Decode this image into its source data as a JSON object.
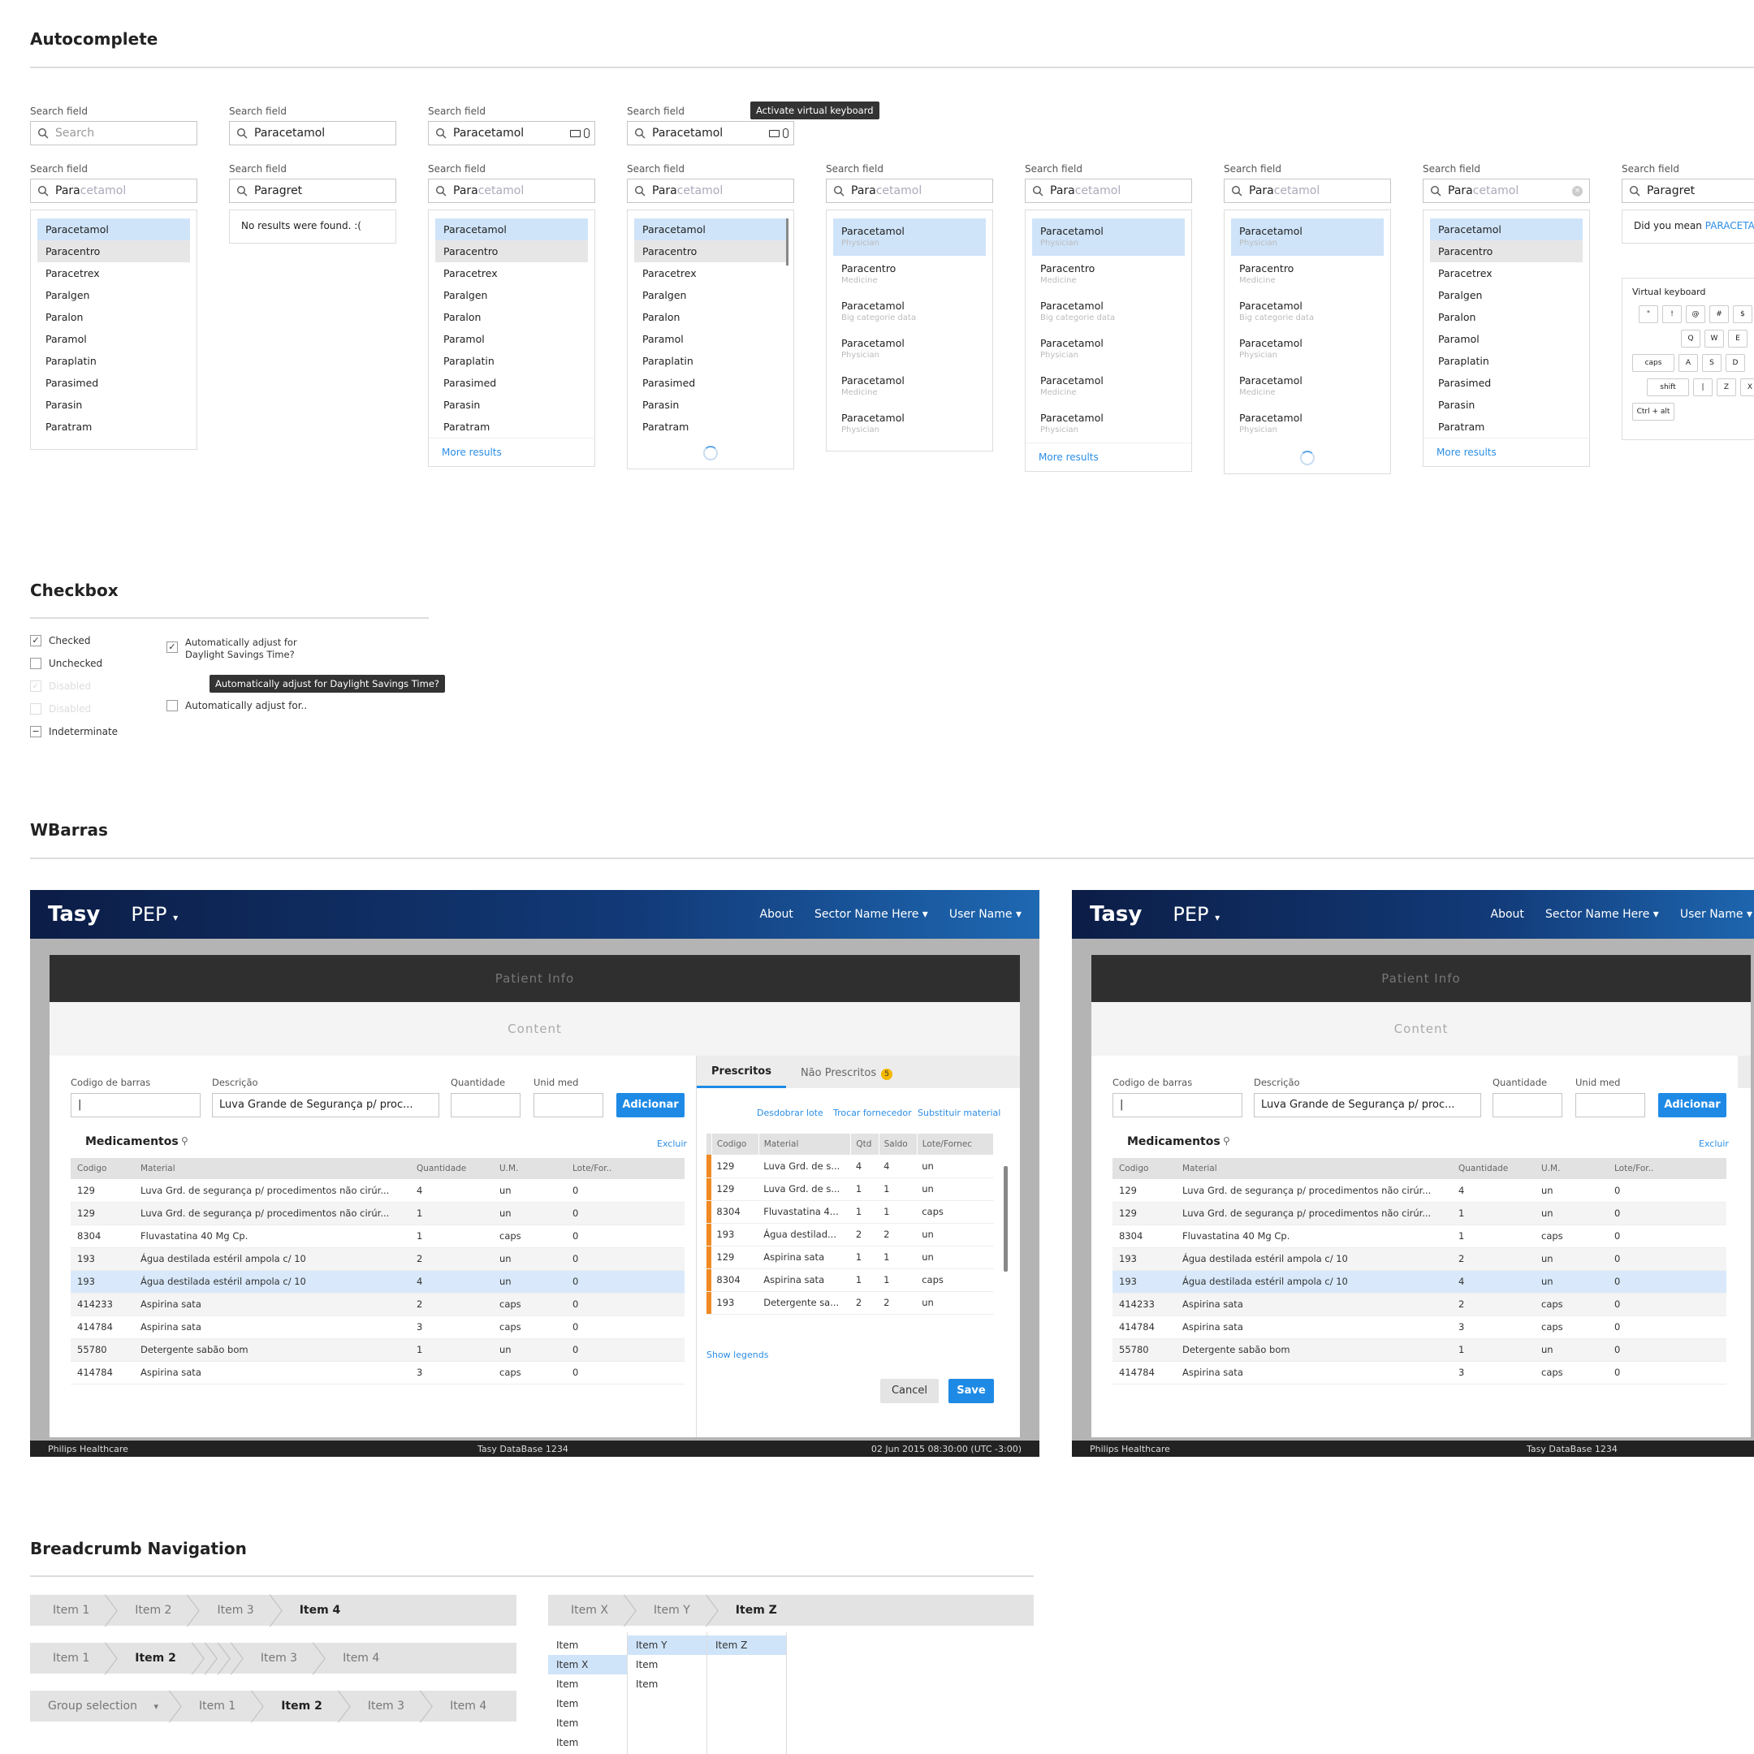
{
  "autocomplete": {
    "title": "Autocomplete",
    "field_label": "Search field",
    "row1": [
      {
        "value": "",
        "placeholder": "Search"
      },
      {
        "value": "Paracetamol"
      },
      {
        "value": "Paracetamol"
      },
      {
        "value": "Paracetamol",
        "tooltip": "Activate virtual keyboard"
      }
    ],
    "typed": "Para",
    "ghost": "cetamol",
    "paragret": "Paragret",
    "no_results": "No results were found. :(",
    "did_you_mean": "Did you mean",
    "did_you_mean_link": "PARACETAI",
    "list": [
      "Paracetamol",
      "Paracentro",
      "Paracetrex",
      "Paralgen",
      "Paralon",
      "Paramol",
      "Paraplatin",
      "Parasimed",
      "Parasin",
      "Paratram"
    ],
    "rich_list": [
      {
        "name": "Paracetamol",
        "sub": "Physician"
      },
      {
        "name": "Paracentro",
        "sub": "Medicine"
      },
      {
        "name": "Paracetamol",
        "sub": "Big categorie data"
      },
      {
        "name": "Paracetamol",
        "sub": "Physician"
      },
      {
        "name": "Paracetamol",
        "sub": "Medicine"
      },
      {
        "name": "Paracetamol",
        "sub": "Physician"
      }
    ],
    "more_results": "More results",
    "vk_title": "Virtual keyboard",
    "vk_row1": [
      "\"",
      "!",
      "@",
      "#",
      "$"
    ],
    "vk_row2": [
      "Q",
      "W",
      "E"
    ],
    "vk_row3": [
      "caps",
      "A",
      "S",
      "D"
    ],
    "vk_row4": [
      "shift",
      "|",
      "Z",
      "X"
    ],
    "vk_row5": [
      "Ctrl + alt"
    ]
  },
  "checkbox": {
    "title": "Checkbox",
    "items": [
      "Checked",
      "Unchecked",
      "Disabled",
      "Disabled",
      "Indeterminate"
    ],
    "long1": "Automatically adjust for",
    "long2": "Daylight Savings Time?",
    "tooltip": "Automatically adjust for Daylight Savings Time?",
    "trunc": "Automatically adjust for.."
  },
  "wbarras": {
    "title": "WBarras",
    "brand": "Tasy",
    "module": "PEP",
    "nav": [
      "About",
      "Sector Name Here",
      "User Name"
    ],
    "patient_info": "Patient Info",
    "content": "Content",
    "labels": {
      "barcode": "Codigo de barras",
      "desc": "Descrição",
      "qty": "Quantidade",
      "unit": "Unid med"
    },
    "desc_value": "Luva Grande de Segurança p/ proc...",
    "add_btn": "Adicionar",
    "med_title": "Medicamentos",
    "excluir": "Excluir",
    "med_headers": [
      "Codigo",
      "Material",
      "Quantidade",
      "U.M.",
      "Lote/For.."
    ],
    "med_rows": [
      [
        "129",
        "Luva Grd. de segurança p/ procedimentos não cirúr...",
        "4",
        "un",
        "0"
      ],
      [
        "129",
        "Luva Grd. de segurança p/ procedimentos não cirúr...",
        "1",
        "un",
        "0"
      ],
      [
        "8304",
        "Fluvastatina 40 Mg Cp.",
        "1",
        "caps",
        "0"
      ],
      [
        "193",
        "Água destilada estéril ampola c/ 10",
        "2",
        "un",
        "0"
      ],
      [
        "193",
        "Água destilada estéril ampola c/ 10",
        "4",
        "un",
        "0"
      ],
      [
        "414233",
        "Aspirina sata",
        "2",
        "caps",
        "0"
      ],
      [
        "414784",
        "Aspirina sata",
        "3",
        "caps",
        "0"
      ],
      [
        "55780",
        "Detergente sabão bom",
        "1",
        "un",
        "0"
      ],
      [
        "414784",
        "Aspirina sata",
        "3",
        "caps",
        "0"
      ]
    ],
    "tab_prescritos": "Prescritos",
    "tab_nao": "Não Prescritos",
    "tab_badge": "5",
    "actions": [
      "Desdobrar lote",
      "Trocar fornecedor",
      "Substituir material"
    ],
    "p_headers": [
      "Codigo",
      "Material",
      "Qtd",
      "Saldo",
      "Lote/Fornec"
    ],
    "p_rows": [
      [
        "129",
        "Luva Grd. de s...",
        "4",
        "4",
        "un"
      ],
      [
        "129",
        "Luva Grd. de s...",
        "1",
        "1",
        "un"
      ],
      [
        "8304",
        "Fluvastatina 4...",
        "1",
        "1",
        "caps"
      ],
      [
        "193",
        "Água destilad...",
        "2",
        "2",
        "un"
      ],
      [
        "129",
        "Aspirina sata",
        "1",
        "1",
        "un"
      ],
      [
        "8304",
        "Aspirina sata",
        "1",
        "1",
        "caps"
      ],
      [
        "193",
        "Detergente sa...",
        "2",
        "2",
        "un"
      ]
    ],
    "show_legends": "Show legends",
    "cancel": "Cancel",
    "save": "Save",
    "footer_left": "Philips Healthcare",
    "footer_mid": "Tasy   DataBase 1234",
    "footer_right": "02 Jun 2015   08:30:00  (UTC -3:00)"
  },
  "breadcrumb": {
    "title": "Breadcrumb Navigation",
    "row1": [
      "Item 1",
      "Item 2",
      "Item 3",
      "Item 4"
    ],
    "row2": [
      "Item 1",
      "Item 2",
      "",
      "",
      "",
      "Item 3",
      "Item 4"
    ],
    "row3_group": "Group selection",
    "row3": [
      "Item 1",
      "Item 2",
      "Item 3",
      "Item 4"
    ],
    "xyz": [
      "Item X",
      "Item Y",
      "Item Z"
    ],
    "col1": [
      "Item",
      "Item X",
      "Item",
      "Item",
      "Item",
      "Item"
    ],
    "col2": [
      "Item Y",
      "Item",
      "Item"
    ],
    "col3": [
      "Item Z"
    ]
  }
}
